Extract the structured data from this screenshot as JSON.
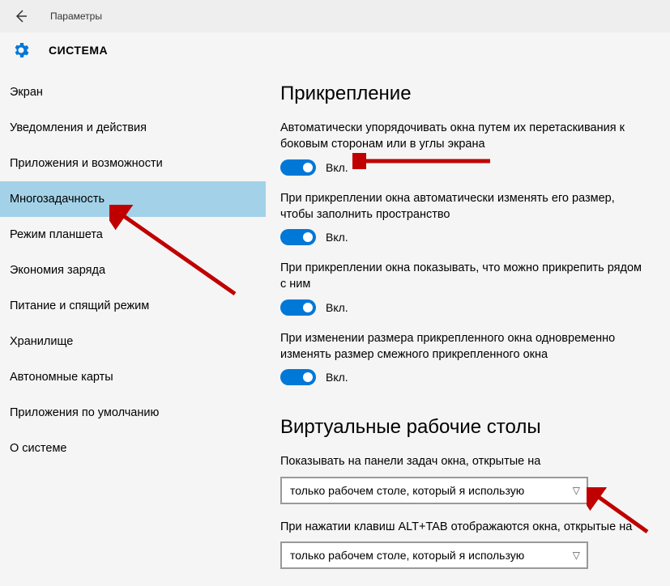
{
  "header": {
    "title": "Параметры"
  },
  "category": {
    "title": "СИСТЕМА"
  },
  "sidebar": {
    "items": [
      {
        "label": "Экран",
        "selected": false
      },
      {
        "label": "Уведомления и действия",
        "selected": false
      },
      {
        "label": "Приложения и возможности",
        "selected": false
      },
      {
        "label": "Многозадачность",
        "selected": true
      },
      {
        "label": "Режим планшета",
        "selected": false
      },
      {
        "label": "Экономия заряда",
        "selected": false
      },
      {
        "label": "Питание и спящий режим",
        "selected": false
      },
      {
        "label": "Хранилище",
        "selected": false
      },
      {
        "label": "Автономные карты",
        "selected": false
      },
      {
        "label": "Приложения по умолчанию",
        "selected": false
      },
      {
        "label": "О системе",
        "selected": false
      }
    ]
  },
  "snap": {
    "heading": "Прикрепление",
    "settings": [
      {
        "desc": "Автоматически упорядочивать окна путем их перетаскивания к боковым сторонам или в углы экрана",
        "state": "Вкл."
      },
      {
        "desc": "При прикреплении окна автоматически изменять его размер, чтобы заполнить пространство",
        "state": "Вкл."
      },
      {
        "desc": "При прикреплении окна показывать, что можно прикрепить рядом с ним",
        "state": "Вкл."
      },
      {
        "desc": "При изменении размера прикрепленного окна одновременно изменять размер смежного прикрепленного окна",
        "state": "Вкл."
      }
    ]
  },
  "vdesktops": {
    "heading": "Виртуальные рабочие столы",
    "taskbar_label": "Показывать на панели задач окна, открытые на",
    "taskbar_value": "только рабочем столе, который я использую",
    "alttab_label": "При нажатии клавиш ALT+TAB отображаются окна, открытые на",
    "alttab_value": "только рабочем столе, который я использую"
  }
}
